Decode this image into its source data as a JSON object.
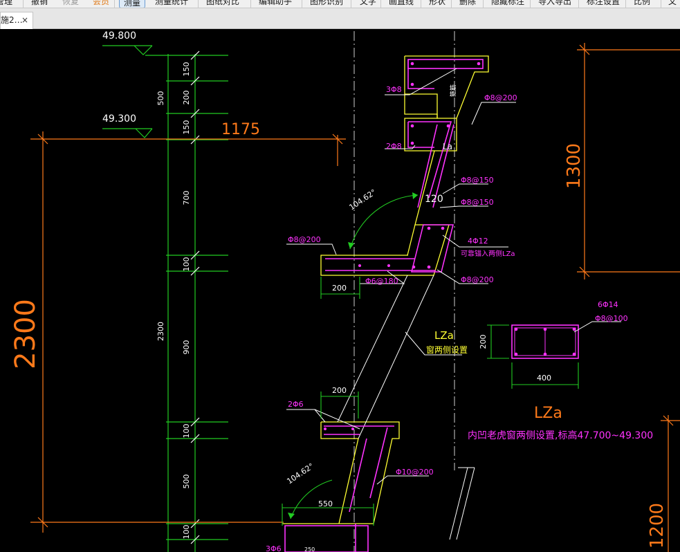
{
  "toolbar": {
    "items": [
      {
        "label": "管理",
        "state": "normal"
      },
      {
        "label": "撤销",
        "state": "normal"
      },
      {
        "label": "恢复",
        "state": "disabled"
      },
      {
        "label": "会员",
        "state": "highlight"
      },
      {
        "label": "测量",
        "state": "active"
      },
      {
        "label": "测量统计",
        "state": "normal"
      },
      {
        "label": "图纸对比",
        "state": "normal"
      },
      {
        "label": "编辑助手",
        "state": "normal"
      },
      {
        "label": "图形识别",
        "state": "normal"
      },
      {
        "label": "文字",
        "state": "normal"
      },
      {
        "label": "画直线",
        "state": "normal"
      },
      {
        "label": "形状",
        "state": "normal"
      },
      {
        "label": "删除",
        "state": "normal"
      },
      {
        "label": "隐藏标注",
        "state": "normal"
      },
      {
        "label": "导入导出",
        "state": "normal"
      },
      {
        "label": "标注设置",
        "state": "normal"
      },
      {
        "label": "比例",
        "state": "normal"
      },
      {
        "label": "文",
        "state": "normal"
      }
    ]
  },
  "tab": {
    "title": "施2…",
    "close": "×"
  },
  "drawing": {
    "colors": {
      "background": "#000000",
      "dimension_orange": "#ff7a1a",
      "grid_green": "#22cc22",
      "rebar_magenta": "#ff33ff",
      "concrete_yellow": "#ffff33",
      "text_white": "#ffffff"
    },
    "elevations": {
      "top": "49.800",
      "second": "49.300"
    },
    "dims": {
      "big_left": "2300",
      "span_top": "1175",
      "right_top": "1300",
      "right_bottom": "1200",
      "v150a": "150",
      "v200": "200",
      "v150b": "150",
      "v500a": "500",
      "v700": "700",
      "v100a": "100",
      "v2300": "2300",
      "v900": "900",
      "v100b": "100",
      "v500b": "500",
      "v100c": "100",
      "w200a": "200",
      "w200b": "200",
      "w550": "550",
      "w400": "400",
      "h200": "200",
      "w250": "250"
    },
    "labels": {
      "r3d8": "3Φ8",
      "r2d8": "2Φ8",
      "phi8_200_top": "Φ8@200",
      "la": "La",
      "phi8_150a": "Φ8@150",
      "phi8_150b": "Φ8@150",
      "angle_top": "104.62°",
      "n120": "120",
      "r4d12": "4Φ12",
      "lza_note": "可靠锚入两侧LZa",
      "phi8_200_left": "Φ8@200",
      "phi8_200_mid": "Φ8@200",
      "phi6_180": "Φ6@180",
      "lza": "LZa",
      "window_both_sides": "窗两侧设置",
      "r6d14": "6Φ14",
      "phi8_100": "Φ8@100",
      "lza_section": "LZa",
      "section_note": "内凹老虎窗两侧设置,标高47.700~49.300",
      "r2d6": "2Φ6",
      "phi10_200": "Φ10@200",
      "angle_bottom": "104.62°",
      "r3d6": "3Φ6",
      "stirrup_side": "箍筋"
    }
  }
}
